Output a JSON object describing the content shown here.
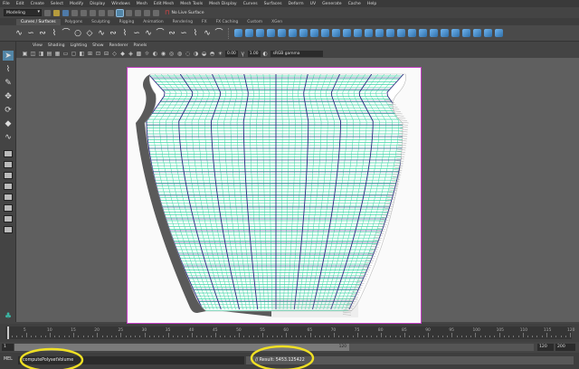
{
  "menubar": {
    "items": [
      "File",
      "Edit",
      "Create",
      "Select",
      "Modify",
      "Display",
      "Windows",
      "Mesh",
      "Edit Mesh",
      "Mesh Tools",
      "Mesh Display",
      "Curves",
      "Surfaces",
      "Deform",
      "UV",
      "Generate",
      "Cache",
      "Help"
    ]
  },
  "statusline": {
    "mode": "Modeling",
    "live_surface": "No Live Surface"
  },
  "shelf_tabs": [
    "Curves / Surfaces",
    "Polygons",
    "Sculpting",
    "Rigging",
    "Animation",
    "Rendering",
    "FX",
    "FX Caching",
    "Custom",
    "XGen"
  ],
  "panel_menu": [
    "View",
    "Shading",
    "Lighting",
    "Show",
    "Renderer",
    "Panels"
  ],
  "panel_toolbar": {
    "near_value": "0.00",
    "far_value": "1.00",
    "color_management": "sRGB gamma"
  },
  "timeline": {
    "tick_labels": [
      "5",
      "10",
      "15",
      "20",
      "25",
      "30",
      "35",
      "40",
      "45",
      "50",
      "55",
      "60",
      "65",
      "70",
      "75",
      "80",
      "85",
      "90",
      "95",
      "100",
      "105",
      "110",
      "115",
      "120"
    ]
  },
  "range": {
    "start": "1",
    "current": "1",
    "range_end": "120",
    "end": "120",
    "anim_end": "200"
  },
  "command_line": {
    "language": "MEL",
    "input": "computePolysetVolume",
    "result": "// Result: 5453.125422"
  },
  "colors": {
    "accent": "#5285a6",
    "wire_green": "#3fd6a6",
    "wire_blue": "#2a2a80",
    "resgate": "#c43ec4",
    "annotation": "#f0e024"
  }
}
